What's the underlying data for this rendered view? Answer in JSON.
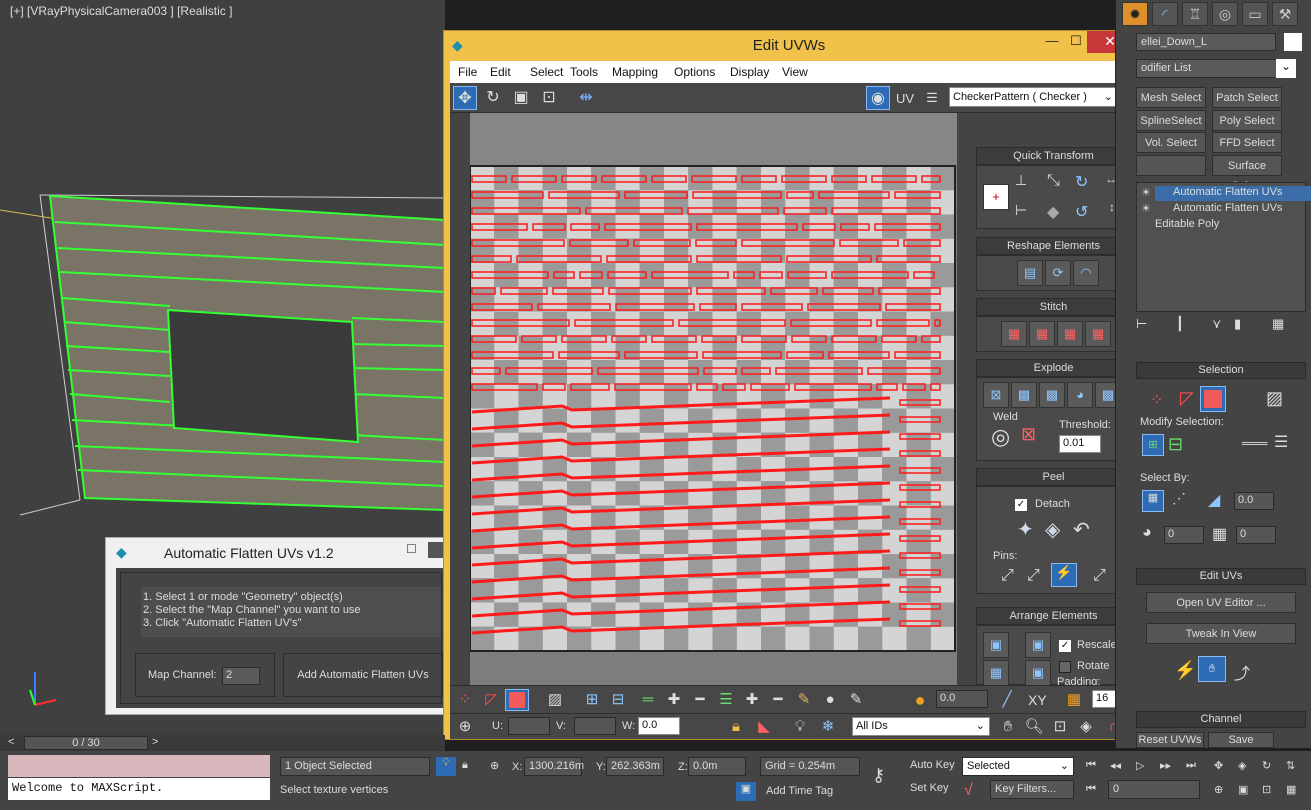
{
  "viewport": {
    "label": "[+] [VRayPhysicalCamera003 ] [Realistic ]"
  },
  "uvw_window": {
    "title": "Edit UVWs",
    "minimize": "—",
    "maximize": "☐",
    "close": "✕",
    "menu": [
      "File",
      "Edit",
      "Select",
      "Tools",
      "Mapping",
      "Options",
      "Display",
      "View"
    ],
    "uv_label": "UV",
    "texture": "CheckerPattern  ( Checker )",
    "rollouts": {
      "quick_transform": "Quick Transform",
      "reshape": "Reshape Elements",
      "stitch": "Stitch",
      "explode": "Explode",
      "weld": "Weld",
      "threshold_label": "Threshold:",
      "threshold_value": "0.01",
      "peel": "Peel",
      "detach": "Detach",
      "pins": "Pins:",
      "arrange": "Arrange Elements",
      "rescale": "Rescale",
      "rotate": "Rotate",
      "padding": "Padding:"
    },
    "bottom": {
      "soft_value": "0.0",
      "xy": "XY",
      "grid_value": "16",
      "u_label": "U:",
      "v_label": "V:",
      "w_label": "W:",
      "w_value": "0.0",
      "ids": "All IDs"
    }
  },
  "afu_dialog": {
    "title": "Automatic Flatten UVs v1.2",
    "steps": [
      "1. Select 1 or mode \"Geometry\" object(s)",
      "2. Select the \"Map Channel\" you want to use",
      "3. Click \"Automatic Flatten UV's\""
    ],
    "map_channel_label": "Map Channel:",
    "map_channel_value": "2",
    "add_button": "Add Automatic Flatten UVs"
  },
  "command_panel": {
    "object_name": "ellei_Down_L",
    "modifier_list": "odifier List",
    "buttons": [
      "Mesh Select",
      "Patch Select",
      "SplineSelect",
      "Poly Select",
      "Vol. Select",
      "FFD Select",
      "",
      "Surface Select"
    ],
    "stack": [
      "Automatic Flatten UVs",
      "Automatic Flatten UVs",
      "Editable Poly"
    ],
    "selection_title": "Selection",
    "modify_selection": "Modify Selection:",
    "select_by": "Select By:",
    "spin_a": "0.0",
    "spin_b": "0",
    "spin_c": "0",
    "edit_uvs_title": "Edit UVs",
    "open_uv_editor": "Open UV Editor ...",
    "tweak_in_view": "Tweak In View",
    "channel_title": "Channel",
    "reset_uvws": "Reset UVWs",
    "save": "Save"
  },
  "timeline": {
    "frame": "0 / 30",
    "prev": "<",
    "next": ">"
  },
  "status": {
    "maxscript_top": "",
    "maxscript_bottom": "Welcome to MAXScript.",
    "selection": "1 Object Selected",
    "prompt": "Select texture vertices",
    "x_label": "X:",
    "x_value": "1300.216m",
    "y_label": "Y:",
    "y_value": "262.363m",
    "z_label": "Z:",
    "z_value": "0.0m",
    "grid": "Grid = 0.254m",
    "add_time_tag": "Add Time Tag",
    "auto_key": "Auto Key",
    "set_key": "Set Key",
    "key_mode": "Selected",
    "key_filters": "Key Filters...",
    "frame_value": "0"
  }
}
